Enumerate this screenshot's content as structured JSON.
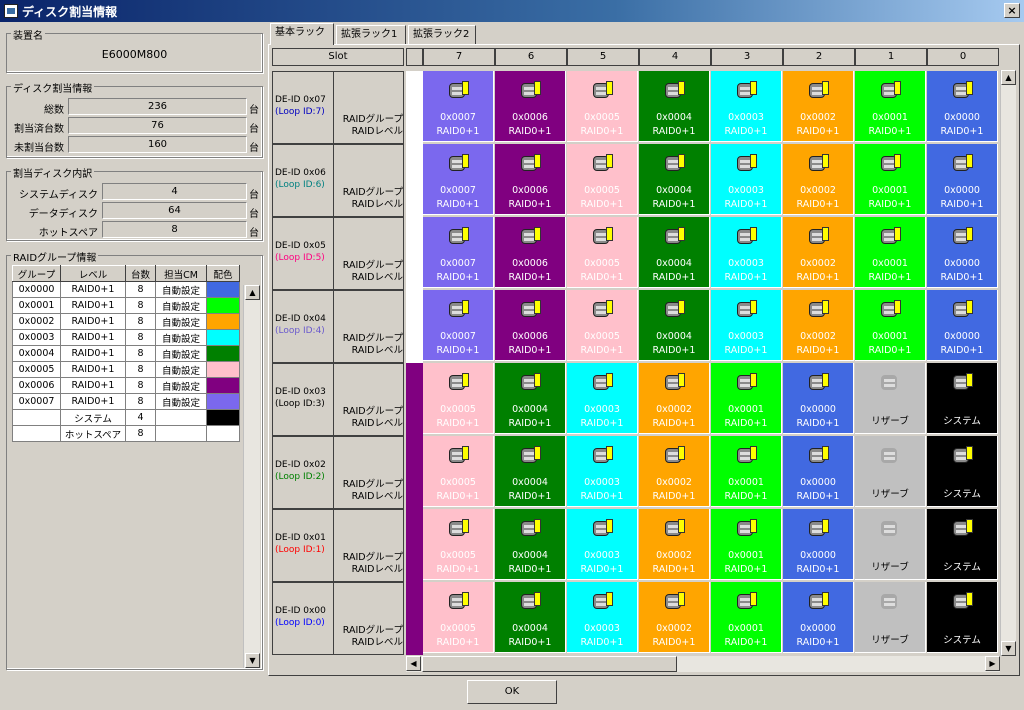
{
  "window": {
    "title": "ディスク割当情報",
    "close": "×"
  },
  "device": {
    "label": "装置名",
    "name": "E6000M800"
  },
  "disk_alloc": {
    "label": "ディスク割当情報",
    "rows": [
      {
        "label": "総数",
        "value": "236",
        "unit": "台"
      },
      {
        "label": "割当済台数",
        "value": "76",
        "unit": "台"
      },
      {
        "label": "未割当台数",
        "value": "160",
        "unit": "台"
      }
    ]
  },
  "alloc_detail": {
    "label": "割当ディスク内訳",
    "rows": [
      {
        "label": "システムディスク",
        "value": "4",
        "unit": "台"
      },
      {
        "label": "データディスク",
        "value": "64",
        "unit": "台"
      },
      {
        "label": "ホットスペア",
        "value": "8",
        "unit": "台"
      }
    ]
  },
  "raid_info": {
    "label": "RAIDグループ情報",
    "headers": [
      "グループ",
      "レベル",
      "台数",
      "担当CM",
      "配色"
    ],
    "rows": [
      {
        "group": "0x0000",
        "level": "RAID0+1",
        "count": "8",
        "cm": "自動設定",
        "color": "#4169e1"
      },
      {
        "group": "0x0001",
        "level": "RAID0+1",
        "count": "8",
        "cm": "自動設定",
        "color": "#00ff00"
      },
      {
        "group": "0x0002",
        "level": "RAID0+1",
        "count": "8",
        "cm": "自動設定",
        "color": "#ffa500"
      },
      {
        "group": "0x0003",
        "level": "RAID0+1",
        "count": "8",
        "cm": "自動設定",
        "color": "#00ffff"
      },
      {
        "group": "0x0004",
        "level": "RAID0+1",
        "count": "8",
        "cm": "自動設定",
        "color": "#008000"
      },
      {
        "group": "0x0005",
        "level": "RAID0+1",
        "count": "8",
        "cm": "自動設定",
        "color": "#ffc0cb"
      },
      {
        "group": "0x0006",
        "level": "RAID0+1",
        "count": "8",
        "cm": "自動設定",
        "color": "#800080"
      },
      {
        "group": "0x0007",
        "level": "RAID0+1",
        "count": "8",
        "cm": "自動設定",
        "color": "#7b68ee"
      },
      {
        "group": "",
        "level": "システム",
        "count": "4",
        "cm": "",
        "color": "#000000"
      },
      {
        "group": "",
        "level": "ホットスペア",
        "count": "8",
        "cm": "",
        "color": "#ffffff"
      }
    ]
  },
  "tabs": [
    "基本ラック",
    "拡張ラック1",
    "拡張ラック2"
  ],
  "slot_header": "Slot",
  "slots": [
    "7",
    "6",
    "5",
    "4",
    "3",
    "2",
    "1",
    "0"
  ],
  "rg_label": [
    "RAIDグループ",
    "RAIDレベル"
  ],
  "rack_rows": [
    {
      "de": "DE-ID 0x07",
      "loop": "(Loop ID:7)",
      "loop_color": "#0000c0",
      "stripe": "#ffffff",
      "cells": [
        {
          "t": "0x0007",
          "l": "RAID0+1",
          "bg": "#7b68ee",
          "fg": "#ffffff"
        },
        {
          "t": "0x0006",
          "l": "RAID0+1",
          "bg": "#800080",
          "fg": "#ffffff"
        },
        {
          "t": "0x0005",
          "l": "RAID0+1",
          "bg": "#ffc0cb",
          "fg": "#ffffff"
        },
        {
          "t": "0x0004",
          "l": "RAID0+1",
          "bg": "#008000",
          "fg": "#ffffff"
        },
        {
          "t": "0x0003",
          "l": "RAID0+1",
          "bg": "#00ffff",
          "fg": "#ffffff"
        },
        {
          "t": "0x0002",
          "l": "RAID0+1",
          "bg": "#ffa500",
          "fg": "#ffffff"
        },
        {
          "t": "0x0001",
          "l": "RAID0+1",
          "bg": "#00ff00",
          "fg": "#ffffff"
        },
        {
          "t": "0x0000",
          "l": "RAID0+1",
          "bg": "#4169e1",
          "fg": "#ffffff"
        }
      ]
    },
    {
      "de": "DE-ID 0x06",
      "loop": "(Loop ID:6)",
      "loop_color": "#008080",
      "stripe": "#ffffff",
      "cells": [
        {
          "t": "0x0007",
          "l": "RAID0+1",
          "bg": "#7b68ee",
          "fg": "#ffffff"
        },
        {
          "t": "0x0006",
          "l": "RAID0+1",
          "bg": "#800080",
          "fg": "#ffffff"
        },
        {
          "t": "0x0005",
          "l": "RAID0+1",
          "bg": "#ffc0cb",
          "fg": "#ffffff"
        },
        {
          "t": "0x0004",
          "l": "RAID0+1",
          "bg": "#008000",
          "fg": "#ffffff"
        },
        {
          "t": "0x0003",
          "l": "RAID0+1",
          "bg": "#00ffff",
          "fg": "#ffffff"
        },
        {
          "t": "0x0002",
          "l": "RAID0+1",
          "bg": "#ffa500",
          "fg": "#ffffff"
        },
        {
          "t": "0x0001",
          "l": "RAID0+1",
          "bg": "#00ff00",
          "fg": "#ffffff"
        },
        {
          "t": "0x0000",
          "l": "RAID0+1",
          "bg": "#4169e1",
          "fg": "#ffffff"
        }
      ]
    },
    {
      "de": "DE-ID 0x05",
      "loop": "(Loop ID:5)",
      "loop_color": "#ff0080",
      "stripe": "#ffffff",
      "cells": [
        {
          "t": "0x0007",
          "l": "RAID0+1",
          "bg": "#7b68ee",
          "fg": "#ffffff"
        },
        {
          "t": "0x0006",
          "l": "RAID0+1",
          "bg": "#800080",
          "fg": "#ffffff"
        },
        {
          "t": "0x0005",
          "l": "RAID0+1",
          "bg": "#ffc0cb",
          "fg": "#ffffff"
        },
        {
          "t": "0x0004",
          "l": "RAID0+1",
          "bg": "#008000",
          "fg": "#ffffff"
        },
        {
          "t": "0x0003",
          "l": "RAID0+1",
          "bg": "#00ffff",
          "fg": "#ffffff"
        },
        {
          "t": "0x0002",
          "l": "RAID0+1",
          "bg": "#ffa500",
          "fg": "#ffffff"
        },
        {
          "t": "0x0001",
          "l": "RAID0+1",
          "bg": "#00ff00",
          "fg": "#ffffff"
        },
        {
          "t": "0x0000",
          "l": "RAID0+1",
          "bg": "#4169e1",
          "fg": "#ffffff"
        }
      ]
    },
    {
      "de": "DE-ID 0x04",
      "loop": "(Loop ID:4)",
      "loop_color": "#6a5acd",
      "stripe": "#ffffff",
      "cells": [
        {
          "t": "0x0007",
          "l": "RAID0+1",
          "bg": "#7b68ee",
          "fg": "#ffffff"
        },
        {
          "t": "0x0006",
          "l": "RAID0+1",
          "bg": "#800080",
          "fg": "#ffffff"
        },
        {
          "t": "0x0005",
          "l": "RAID0+1",
          "bg": "#ffc0cb",
          "fg": "#ffffff"
        },
        {
          "t": "0x0004",
          "l": "RAID0+1",
          "bg": "#008000",
          "fg": "#ffffff"
        },
        {
          "t": "0x0003",
          "l": "RAID0+1",
          "bg": "#00ffff",
          "fg": "#ffffff"
        },
        {
          "t": "0x0002",
          "l": "RAID0+1",
          "bg": "#ffa500",
          "fg": "#ffffff"
        },
        {
          "t": "0x0001",
          "l": "RAID0+1",
          "bg": "#00ff00",
          "fg": "#ffffff"
        },
        {
          "t": "0x0000",
          "l": "RAID0+1",
          "bg": "#4169e1",
          "fg": "#ffffff"
        }
      ]
    },
    {
      "de": "DE-ID 0x03",
      "loop": "(Loop ID:3)",
      "loop_color": "#000000",
      "stripe": "#800080",
      "cells": [
        {
          "t": "0x0005",
          "l": "RAID0+1",
          "bg": "#ffc0cb",
          "fg": "#ffffff"
        },
        {
          "t": "0x0004",
          "l": "RAID0+1",
          "bg": "#008000",
          "fg": "#ffffff"
        },
        {
          "t": "0x0003",
          "l": "RAID0+1",
          "bg": "#00ffff",
          "fg": "#ffffff"
        },
        {
          "t": "0x0002",
          "l": "RAID0+1",
          "bg": "#ffa500",
          "fg": "#ffffff"
        },
        {
          "t": "0x0001",
          "l": "RAID0+1",
          "bg": "#00ff00",
          "fg": "#ffffff"
        },
        {
          "t": "0x0000",
          "l": "RAID0+1",
          "bg": "#4169e1",
          "fg": "#ffffff"
        },
        {
          "t": "",
          "l": "リザーブ",
          "bg": "#c0c0c0",
          "fg": "#000000"
        },
        {
          "t": "",
          "l": "システム",
          "bg": "#000000",
          "fg": "#ffffff"
        }
      ]
    },
    {
      "de": "DE-ID 0x02",
      "loop": "(Loop ID:2)",
      "loop_color": "#008000",
      "stripe": "#800080",
      "cells": [
        {
          "t": "0x0005",
          "l": "RAID0+1",
          "bg": "#ffc0cb",
          "fg": "#ffffff"
        },
        {
          "t": "0x0004",
          "l": "RAID0+1",
          "bg": "#008000",
          "fg": "#ffffff"
        },
        {
          "t": "0x0003",
          "l": "RAID0+1",
          "bg": "#00ffff",
          "fg": "#ffffff"
        },
        {
          "t": "0x0002",
          "l": "RAID0+1",
          "bg": "#ffa500",
          "fg": "#ffffff"
        },
        {
          "t": "0x0001",
          "l": "RAID0+1",
          "bg": "#00ff00",
          "fg": "#ffffff"
        },
        {
          "t": "0x0000",
          "l": "RAID0+1",
          "bg": "#4169e1",
          "fg": "#ffffff"
        },
        {
          "t": "",
          "l": "リザーブ",
          "bg": "#c0c0c0",
          "fg": "#000000"
        },
        {
          "t": "",
          "l": "システム",
          "bg": "#000000",
          "fg": "#ffffff"
        }
      ]
    },
    {
      "de": "DE-ID 0x01",
      "loop": "(Loop ID:1)",
      "loop_color": "#ff0000",
      "stripe": "#800080",
      "cells": [
        {
          "t": "0x0005",
          "l": "RAID0+1",
          "bg": "#ffc0cb",
          "fg": "#ffffff"
        },
        {
          "t": "0x0004",
          "l": "RAID0+1",
          "bg": "#008000",
          "fg": "#ffffff"
        },
        {
          "t": "0x0003",
          "l": "RAID0+1",
          "bg": "#00ffff",
          "fg": "#ffffff"
        },
        {
          "t": "0x0002",
          "l": "RAID0+1",
          "bg": "#ffa500",
          "fg": "#ffffff"
        },
        {
          "t": "0x0001",
          "l": "RAID0+1",
          "bg": "#00ff00",
          "fg": "#ffffff"
        },
        {
          "t": "0x0000",
          "l": "RAID0+1",
          "bg": "#4169e1",
          "fg": "#ffffff"
        },
        {
          "t": "",
          "l": "リザーブ",
          "bg": "#c0c0c0",
          "fg": "#000000"
        },
        {
          "t": "",
          "l": "システム",
          "bg": "#000000",
          "fg": "#ffffff"
        }
      ]
    },
    {
      "de": "DE-ID 0x00",
      "loop": "(Loop ID:0)",
      "loop_color": "#0000ff",
      "stripe": "#800080",
      "cells": [
        {
          "t": "0x0005",
          "l": "RAID0+1",
          "bg": "#ffc0cb",
          "fg": "#ffffff"
        },
        {
          "t": "0x0004",
          "l": "RAID0+1",
          "bg": "#008000",
          "fg": "#ffffff"
        },
        {
          "t": "0x0003",
          "l": "RAID0+1",
          "bg": "#00ffff",
          "fg": "#ffffff"
        },
        {
          "t": "0x0002",
          "l": "RAID0+1",
          "bg": "#ffa500",
          "fg": "#ffffff"
        },
        {
          "t": "0x0001",
          "l": "RAID0+1",
          "bg": "#00ff00",
          "fg": "#ffffff"
        },
        {
          "t": "0x0000",
          "l": "RAID0+1",
          "bg": "#4169e1",
          "fg": "#ffffff"
        },
        {
          "t": "",
          "l": "リザーブ",
          "bg": "#c0c0c0",
          "fg": "#000000"
        },
        {
          "t": "",
          "l": "システム",
          "bg": "#000000",
          "fg": "#ffffff"
        }
      ]
    }
  ],
  "ok_label": "OK",
  "scroll_icons": {
    "up": "▲",
    "down": "▼",
    "left": "◀",
    "right": "▶"
  }
}
